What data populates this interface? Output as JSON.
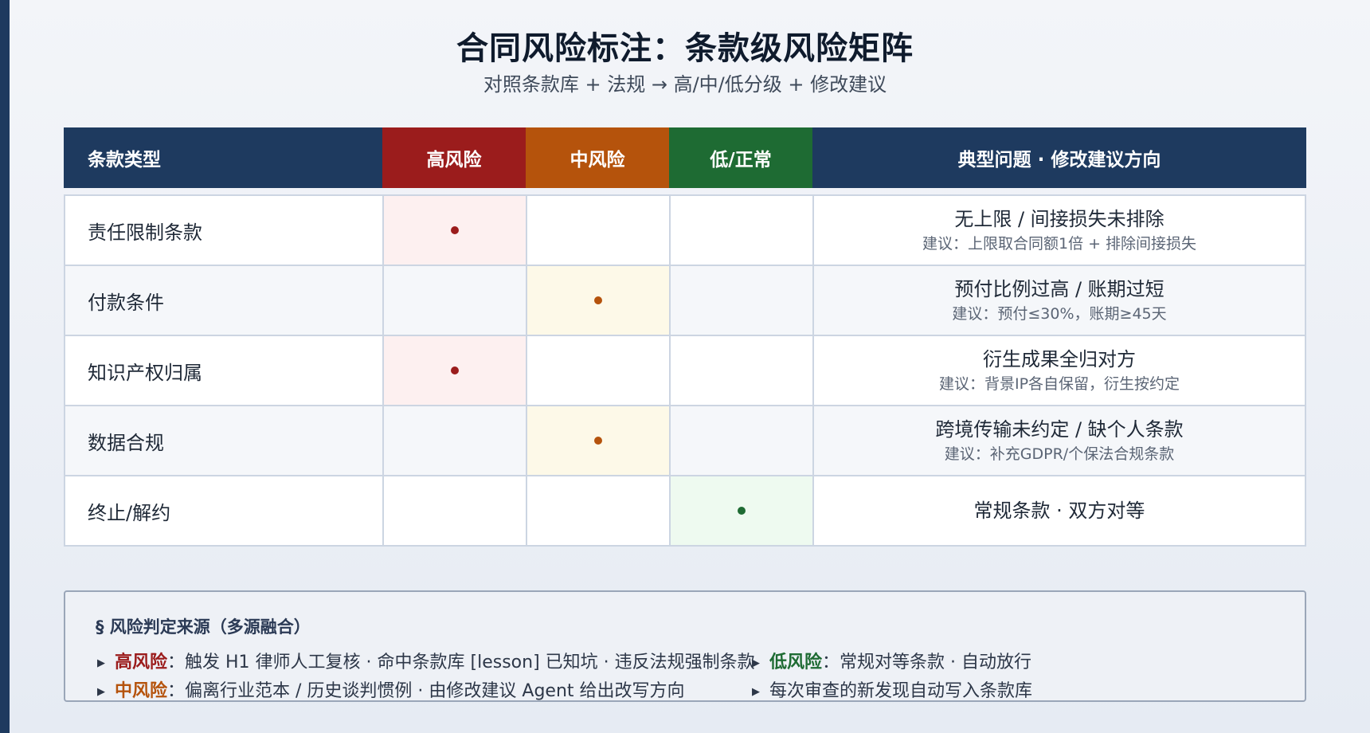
{
  "title": "合同风险标注：条款级风险矩阵",
  "subtitle": "对照条款库 + 法规 → 高/中/低分级 + 修改建议",
  "headers": {
    "clause": "条款类型",
    "high": "高风险",
    "mid": "中风险",
    "low": "低/正常",
    "notes": "典型问题 · 修改建议方向"
  },
  "colors": {
    "navy": "#1e3a5f",
    "high": "#9b1c1c",
    "mid": "#b5530c",
    "low": "#1e6b33"
  },
  "rows": [
    {
      "clause": "责任限制条款",
      "risk": "high",
      "issue": "无上限 / 间接损失未排除",
      "advice": "建议：上限取合同额1倍 + 排除间接损失"
    },
    {
      "clause": "付款条件",
      "risk": "mid",
      "issue": "预付比例过高 / 账期过短",
      "advice": "建议：预付≤30%，账期≥45天"
    },
    {
      "clause": "知识产权归属",
      "risk": "high",
      "issue": "衍生成果全归对方",
      "advice": "建议：背景IP各自保留，衍生按约定"
    },
    {
      "clause": "数据合规",
      "risk": "mid",
      "issue": "跨境传输未约定 / 缺个人条款",
      "advice": "建议：补充GDPR/个保法合规条款"
    },
    {
      "clause": "终止/解约",
      "risk": "low",
      "issue": "常规条款 · 双方对等",
      "advice": ""
    }
  ],
  "legend": {
    "title": "§ 风险判定来源（多源融合）",
    "items": [
      {
        "label": "高风险",
        "level": "high",
        "text": "：触发 H1 律师人工复核 · 命中条款库 [lesson] 已知坑 · 违反法规强制条款"
      },
      {
        "label": "中风险",
        "level": "mid",
        "text": "：偏离行业范本 / 历史谈判惯例 · 由修改建议 Agent 给出改写方向"
      },
      {
        "label": "低风险",
        "level": "low",
        "text": "：常规对等条款 · 自动放行"
      },
      {
        "label": "",
        "level": "",
        "text": "每次审查的新发现自动写入条款库"
      }
    ]
  }
}
